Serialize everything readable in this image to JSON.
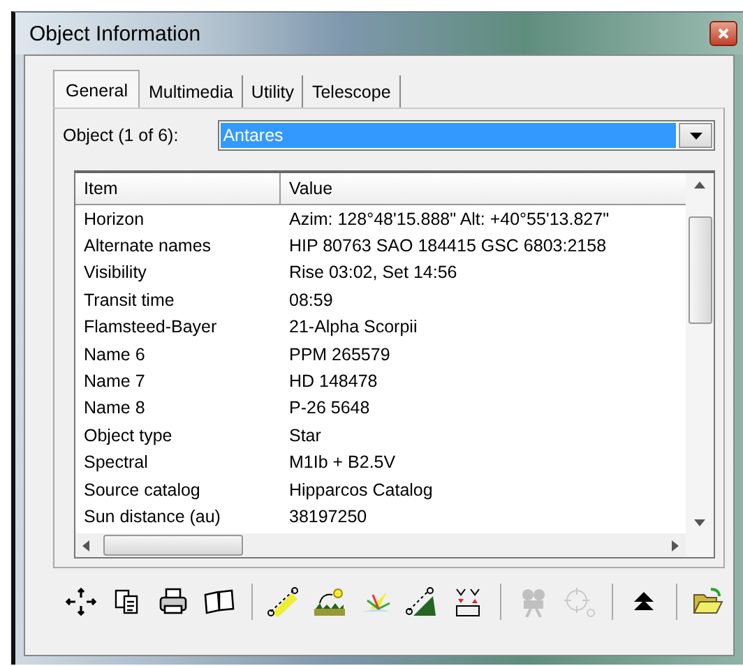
{
  "window": {
    "title": "Object Information"
  },
  "tabs": [
    {
      "label": "General",
      "selected": true
    },
    {
      "label": "Multimedia",
      "selected": false
    },
    {
      "label": "Utility",
      "selected": false
    },
    {
      "label": "Telescope",
      "selected": false
    }
  ],
  "object_selector": {
    "label": "Object (1 of 6):",
    "value": "Antares"
  },
  "table": {
    "columns": [
      "Item",
      "Value"
    ],
    "rows": [
      [
        "Horizon",
        "Azim: 128°48'15.888\"   Alt: +40°55'13.827\""
      ],
      [
        "Alternate names",
        "HIP 80763 SAO 184415  GSC 6803:2158"
      ],
      [
        "Visibility",
        "Rise 03:02,  Set 14:56"
      ],
      [
        "Transit time",
        "08:59"
      ],
      [
        "Flamsteed-Bayer",
        "21-Alpha Scorpii"
      ],
      [
        "Name 6",
        "PPM 265579"
      ],
      [
        "Name 7",
        "HD 148478"
      ],
      [
        "Name 8",
        "P-26 5648"
      ],
      [
        "Object type",
        "Star"
      ],
      [
        "Spectral",
        "M1Ib + B2.5V"
      ],
      [
        "Source catalog",
        "Hipparcos Catalog"
      ],
      [
        "Sun distance (au)",
        "38197250"
      ]
    ]
  },
  "toolbar": [
    {
      "kind": "button",
      "disabled": false
    },
    {
      "kind": "button",
      "disabled": false
    },
    {
      "kind": "button",
      "disabled": false
    },
    {
      "kind": "button",
      "disabled": false
    },
    {
      "kind": "separator"
    },
    {
      "kind": "button",
      "disabled": false
    },
    {
      "kind": "button",
      "disabled": false
    },
    {
      "kind": "button",
      "disabled": false
    },
    {
      "kind": "button",
      "disabled": false
    },
    {
      "kind": "button",
      "disabled": false
    },
    {
      "kind": "separator"
    },
    {
      "kind": "button",
      "disabled": true
    },
    {
      "kind": "button",
      "disabled": true
    },
    {
      "kind": "separator"
    },
    {
      "kind": "button",
      "disabled": false
    },
    {
      "kind": "separator"
    },
    {
      "kind": "button",
      "disabled": false
    }
  ]
}
